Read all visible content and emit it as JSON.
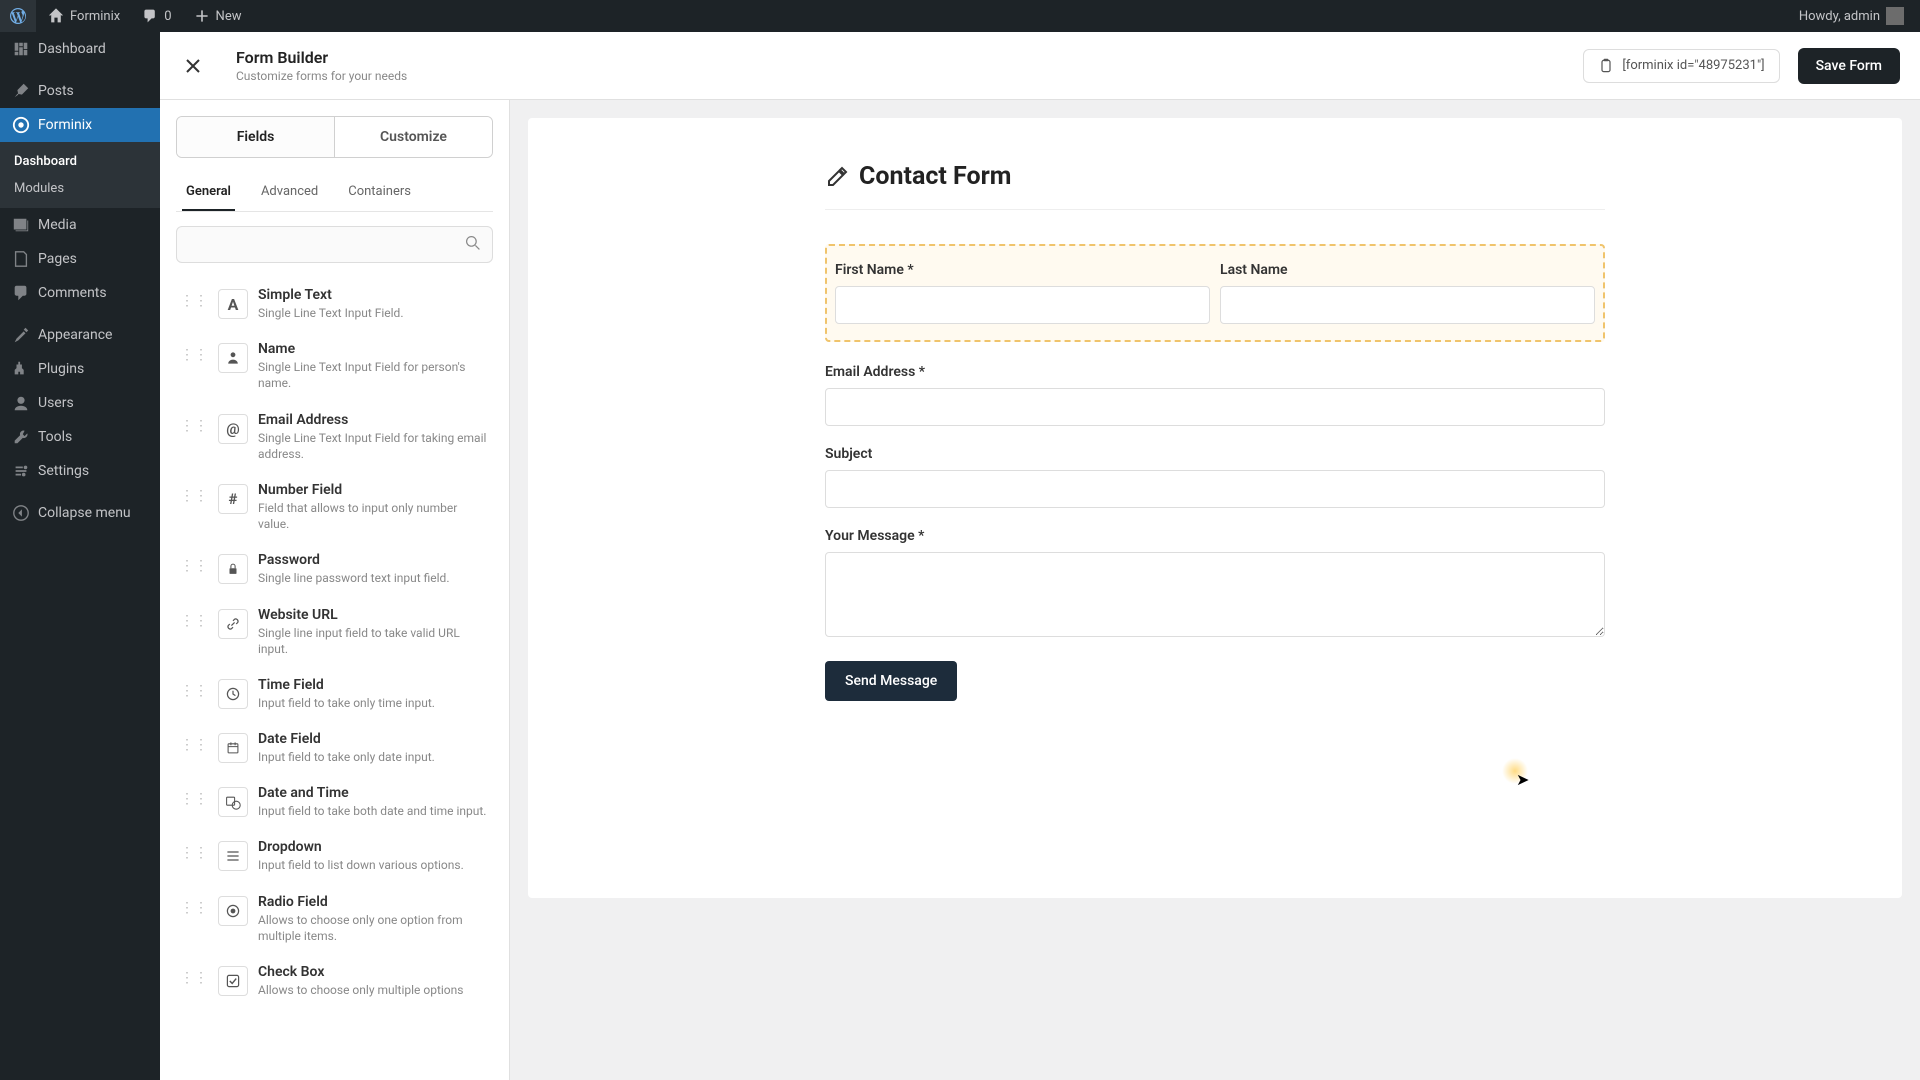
{
  "adminbar": {
    "site_name": "Forminix",
    "comments_count": "0",
    "new_label": "New",
    "howdy": "Howdy, admin"
  },
  "wpmenu": {
    "dashboard": "Dashboard",
    "posts": "Posts",
    "forminix": "Forminix",
    "forminix_sub_dashboard": "Dashboard",
    "forminix_sub_modules": "Modules",
    "media": "Media",
    "pages": "Pages",
    "comments": "Comments",
    "appearance": "Appearance",
    "plugins": "Plugins",
    "users": "Users",
    "tools": "Tools",
    "settings": "Settings",
    "collapse": "Collapse menu"
  },
  "header": {
    "title": "Form Builder",
    "subtitle": "Customize forms for your needs",
    "shortcode": "[forminix id=\"48975231\"]",
    "save": "Save Form"
  },
  "panel": {
    "tab_fields": "Fields",
    "tab_customize": "Customize",
    "sub_general": "General",
    "sub_advanced": "Advanced",
    "sub_containers": "Containers",
    "search_placeholder": ""
  },
  "fields": [
    {
      "title": "Simple Text",
      "desc": "Single Line Text Input Field.",
      "icon": "A"
    },
    {
      "title": "Name",
      "desc": "Single Line Text Input Field for person's name.",
      "icon": "person"
    },
    {
      "title": "Email Address",
      "desc": "Single Line Text Input Field for taking email address.",
      "icon": "@"
    },
    {
      "title": "Number Field",
      "desc": "Field that allows to input only number value.",
      "icon": "#"
    },
    {
      "title": "Password",
      "desc": "Single line password text input field.",
      "icon": "lock"
    },
    {
      "title": "Website URL",
      "desc": "Single line input field to take valid URL input.",
      "icon": "link"
    },
    {
      "title": "Time Field",
      "desc": "Input field to take only time input.",
      "icon": "clock"
    },
    {
      "title": "Date Field",
      "desc": "Input field to take only date input.",
      "icon": "calendar"
    },
    {
      "title": "Date and Time",
      "desc": "Input field to take both date and time input.",
      "icon": "datetime"
    },
    {
      "title": "Dropdown",
      "desc": "Input field to list down various options.",
      "icon": "dropdown"
    },
    {
      "title": "Radio Field",
      "desc": "Allows to choose only one option from multiple items.",
      "icon": "radio"
    },
    {
      "title": "Check Box",
      "desc": "Allows to choose only multiple options",
      "icon": "check"
    }
  ],
  "form": {
    "title": "Contact Form",
    "first_name": "First Name *",
    "last_name": "Last Name",
    "email": "Email Address *",
    "subject": "Subject",
    "message": "Your Message *",
    "submit": "Send Message"
  }
}
